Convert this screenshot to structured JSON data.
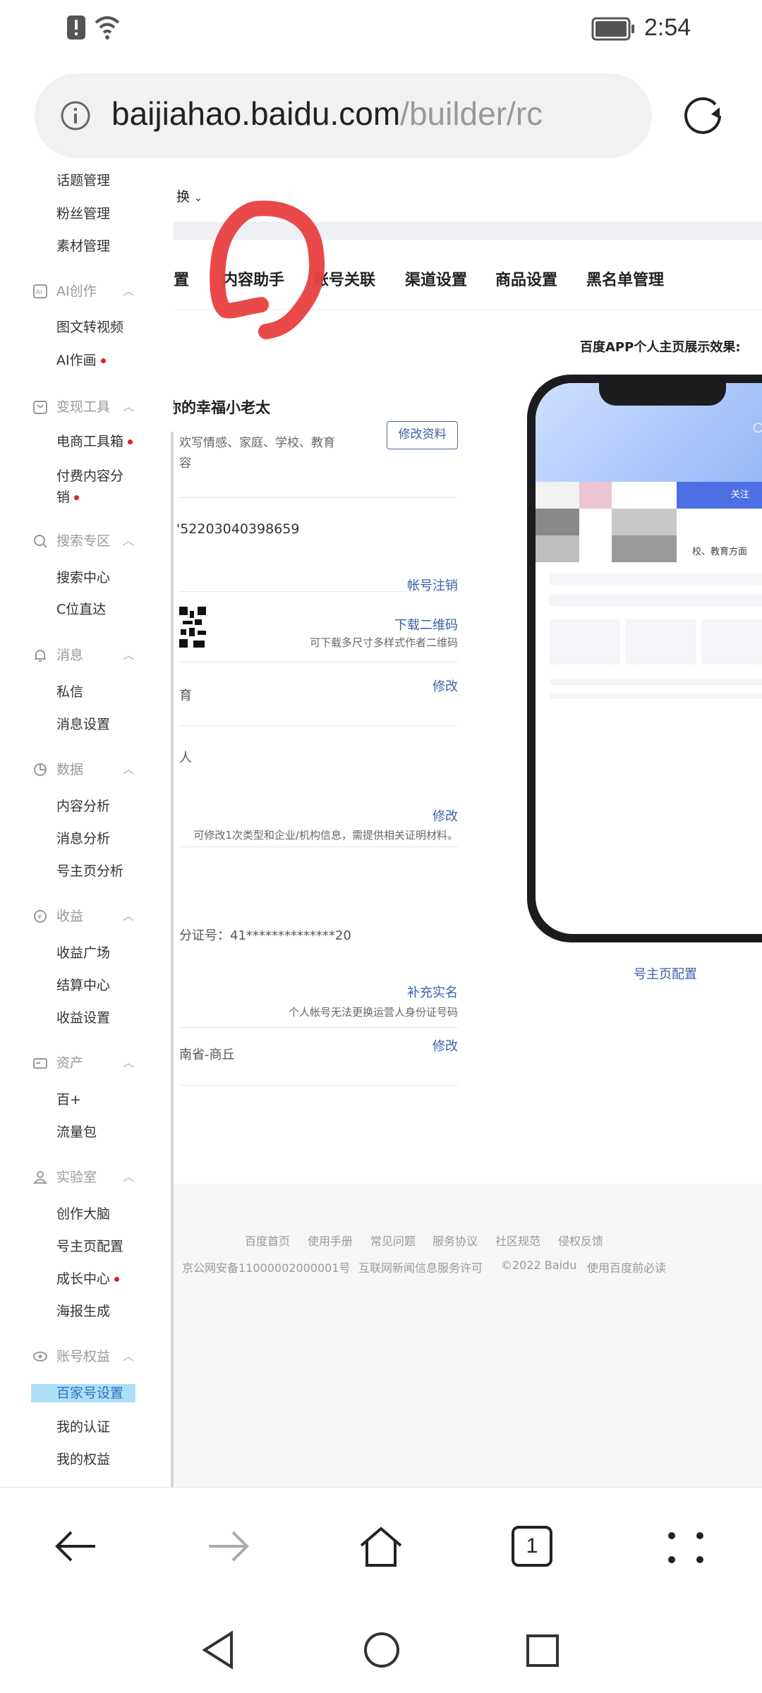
{
  "status_bar": {
    "time": "2:54",
    "icons": [
      "alert-icon",
      "wifi-icon",
      "battery-icon"
    ]
  },
  "browser": {
    "url_host": "baijiahao.baidu.com",
    "url_path": "/builder/rc",
    "info_icon": "info-icon",
    "reload_icon": "reload-icon"
  },
  "sidebar": {
    "entries": [
      {
        "type": "item",
        "label": "话题管理"
      },
      {
        "type": "item",
        "label": "粉丝管理"
      },
      {
        "type": "item",
        "label": "素材管理"
      },
      {
        "type": "group",
        "label": "AI创作",
        "icon": "ai-icon"
      },
      {
        "type": "item",
        "label": "图文转视频"
      },
      {
        "type": "item",
        "label": "AI作画",
        "dot": true
      },
      {
        "type": "group",
        "label": "变现工具",
        "icon": "bag-icon"
      },
      {
        "type": "item",
        "label": "电商工具箱",
        "dot": true
      },
      {
        "type": "item",
        "label": "付费内容分销",
        "dot": true
      },
      {
        "type": "group",
        "label": "搜索专区",
        "icon": "search-icon"
      },
      {
        "type": "item",
        "label": "搜索中心"
      },
      {
        "type": "item",
        "label": "C位直达"
      },
      {
        "type": "group",
        "label": "消息",
        "icon": "bell-icon"
      },
      {
        "type": "item",
        "label": "私信"
      },
      {
        "type": "item",
        "label": "消息设置"
      },
      {
        "type": "group",
        "label": "数据",
        "icon": "pie-chart-icon"
      },
      {
        "type": "item",
        "label": "内容分析"
      },
      {
        "type": "item",
        "label": "消息分析"
      },
      {
        "type": "item",
        "label": "号主页分析"
      },
      {
        "type": "group",
        "label": "收益",
        "icon": "yen-icon"
      },
      {
        "type": "item",
        "label": "收益广场"
      },
      {
        "type": "item",
        "label": "结算中心"
      },
      {
        "type": "item",
        "label": "收益设置"
      },
      {
        "type": "group",
        "label": "资产",
        "icon": "card-icon"
      },
      {
        "type": "item",
        "label": "百+"
      },
      {
        "type": "item",
        "label": "流量包"
      },
      {
        "type": "group",
        "label": "实验室",
        "icon": "lab-icon"
      },
      {
        "type": "item",
        "label": "创作大脑"
      },
      {
        "type": "item",
        "label": "号主页配置"
      },
      {
        "type": "item",
        "label": "成长中心",
        "dot": true
      },
      {
        "type": "item",
        "label": "海报生成"
      },
      {
        "type": "group",
        "label": "账号权益",
        "icon": "eye-icon"
      },
      {
        "type": "item",
        "label": "百家号设置",
        "active": true
      },
      {
        "type": "item",
        "label": "我的认证"
      },
      {
        "type": "item",
        "label": "我的权益"
      }
    ]
  },
  "header": {
    "switch_label": "换"
  },
  "tabs": [
    "置",
    "内容助手",
    "账号关联",
    "渠道设置",
    "商品设置",
    "黑名单管理"
  ],
  "profile": {
    "name_prefix": "你",
    "name": "的幸福小老太",
    "edit_button": "修改资料",
    "bio_line1": "欢写情感、家庭、学校、教育",
    "bio_line2": "容",
    "id_value": "'52203040398659",
    "cancel_account": "帐号注销",
    "download_qr": "下载二维码",
    "download_qr_hint": "可下载多尺寸多样式作者二维码",
    "field_domain_value": "育",
    "field_domain_action": "修改",
    "field_type_value": "人",
    "field_type_action": "修改",
    "field_type_hint": "可修改1次类型和企业/机构信息，需提供相关证明材料。",
    "id_card": "分证号：41**************20",
    "realname_action": "补充实名",
    "realname_hint": "个人帐号无法更换运营人身份证号码",
    "region_value": "南省-商丘",
    "region_action": "修改"
  },
  "preview": {
    "title": "百度APP个人主页展示效果:",
    "follow_button": "关注",
    "bio_fragment": "校、教育方面",
    "config_link": "号主页配置"
  },
  "footer": {
    "links": [
      "百度首页",
      "使用手册",
      "常见问题",
      "服务协议",
      "社区规范",
      "侵权反馈"
    ],
    "legal": [
      "京公网安备11000002000001号",
      "互联网新闻信息服务许可",
      "©2022 Baidu",
      "使用百度前必读"
    ]
  },
  "browser_nav": {
    "tab_count": "1"
  },
  "colors": {
    "accent": "#3c5fa8",
    "annotation": "#e8403f",
    "active_bg": "#ade0f6",
    "dot": "#d9232d"
  }
}
